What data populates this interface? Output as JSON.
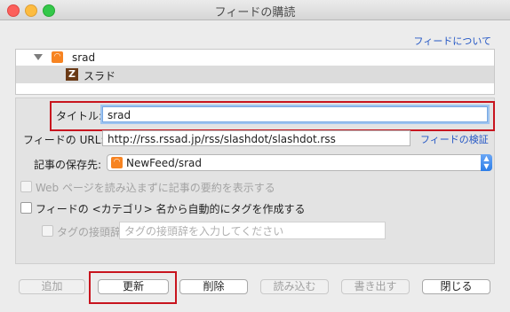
{
  "window": {
    "title": "フィードの購読"
  },
  "about_link": "フィードについて",
  "tree": {
    "feed_name": "srad",
    "child_name": "スラド",
    "child_icon_char": "Z"
  },
  "form": {
    "title_label": "タイトル:",
    "title_value": "srad",
    "url_label": "フィードの URL:",
    "url_value": "http://rss.rssad.jp/rss/slashdot/slashdot.rss",
    "verify_link": "フィードの検証",
    "save_label": "記事の保存先:",
    "save_value": "NewFeed/srad",
    "web_summary_label": "Web ページを読み込まずに記事の要約を表示する",
    "category_tag_label": "フィードの <カテゴリ> 名から自動的にタグを作成する",
    "prefix_label": "タグの接頭辞:",
    "prefix_placeholder": "タグの接頭辞を入力してください"
  },
  "buttons": {
    "add": "追加",
    "update": "更新",
    "delete": "削除",
    "import": "読み込む",
    "export": "書き出す",
    "close": "閉じる"
  },
  "colors": {
    "highlight": "#c8141e",
    "link": "#2457c5",
    "rss": "#f78422",
    "popup_accent": "#2d7ee8"
  },
  "icons": [
    "rss-icon",
    "srad-icon",
    "disclosure-triangle-icon",
    "popup-arrows-icon"
  ]
}
